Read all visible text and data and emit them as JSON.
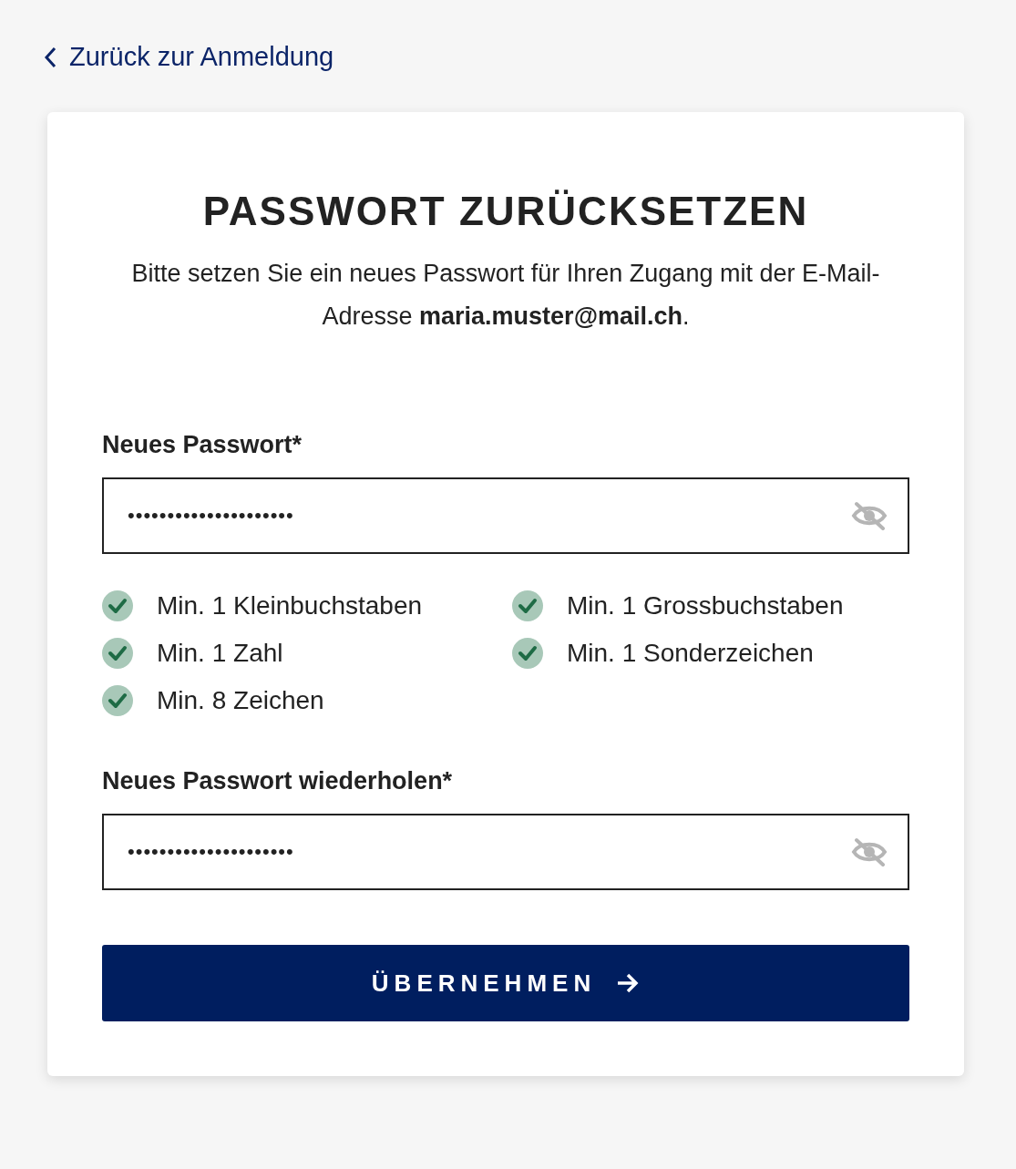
{
  "back_link": {
    "label": "Zurück zur Anmeldung"
  },
  "card": {
    "title": "PASSWORT ZURÜCKSETZEN",
    "description": "Bitte setzen Sie ein neues Passwort für Ihren Zugang mit der E-Mail-Adresse **maria.muster@mail.ch**.",
    "fields": [
      {
        "label": "Neues Passwort*",
        "value": "•••••••••••••••••••••",
        "visible": false
      },
      {
        "label": "Neues Passwort wiederholen*",
        "value": "•••••••••••••••••••••",
        "visible": false
      }
    ],
    "requirements": [
      {
        "label": "Min. 1 Kleinbuchstaben",
        "met": true
      },
      {
        "label": "Min. 1 Grossbuchstaben",
        "met": true
      },
      {
        "label": "Min. 1 Zahl",
        "met": true
      },
      {
        "label": "Min. 1 Sonderzeichen",
        "met": true
      },
      {
        "label": "Min. 8 Zeichen",
        "met": true
      }
    ],
    "submit": {
      "label": "ÜBERNEHMEN"
    }
  }
}
